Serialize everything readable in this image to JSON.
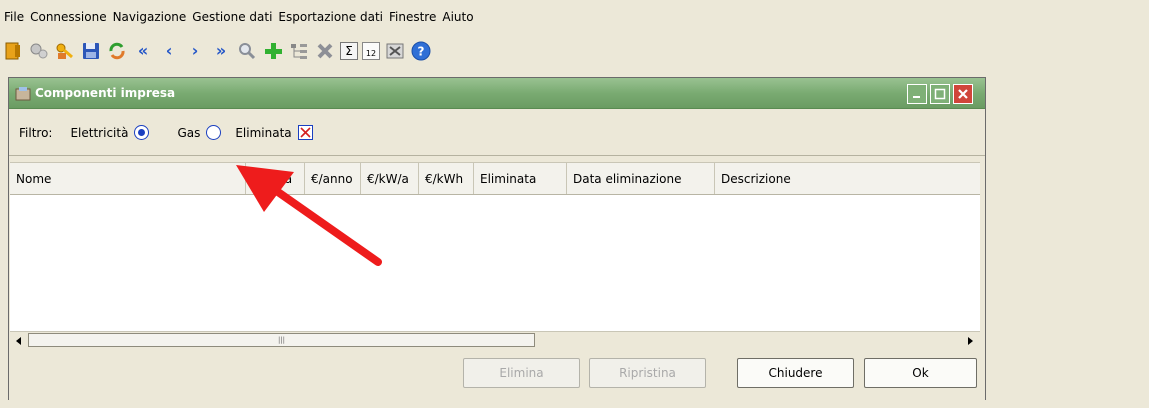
{
  "menu": [
    "File",
    "Connessione",
    "Navigazione",
    "Gestione dati",
    "Esportazione dati",
    "Finestre",
    "Aiuto"
  ],
  "toolbar": {
    "icons": [
      "exit-door-icon",
      "settings-gears-icon",
      "key-hand-icon",
      "save-disk-icon",
      "refresh-icon",
      "first-record-icon",
      "previous-record-icon",
      "next-record-icon",
      "last-record-icon",
      "search-icon",
      "add-icon",
      "tree-icon",
      "delete-icon",
      "sum-icon",
      "calendar-icon",
      "export-icon",
      "help-icon"
    ],
    "first_glyph": "«",
    "prev_glyph": "‹",
    "next_glyph": "›",
    "last_glyph": "»",
    "sum_glyph": "Σ",
    "calendar_label": "12",
    "help_glyph": "?"
  },
  "window": {
    "title": "Componenti impresa",
    "filter_label": "Filtro:",
    "options": [
      {
        "label": "Elettricità",
        "type": "radio",
        "checked": true
      },
      {
        "label": "Gas",
        "type": "radio",
        "checked": false
      },
      {
        "label": "Eliminata",
        "type": "checkbox",
        "checked": true
      }
    ],
    "columns": [
      "Nome",
      "Ordina",
      "€/anno",
      "€/kW/a",
      "€/kWh",
      "Eliminata",
      "Data eliminazione",
      "Descrizione"
    ],
    "scroll_thumb": "|||",
    "buttons": {
      "delete": "Elimina",
      "restore": "Ripristina",
      "close": "Chiudere",
      "ok": "Ok"
    }
  },
  "colors": {
    "title_bar": "#7aab72",
    "close_button": "#d0453a",
    "annotation_arrow": "#ee1c1c"
  }
}
